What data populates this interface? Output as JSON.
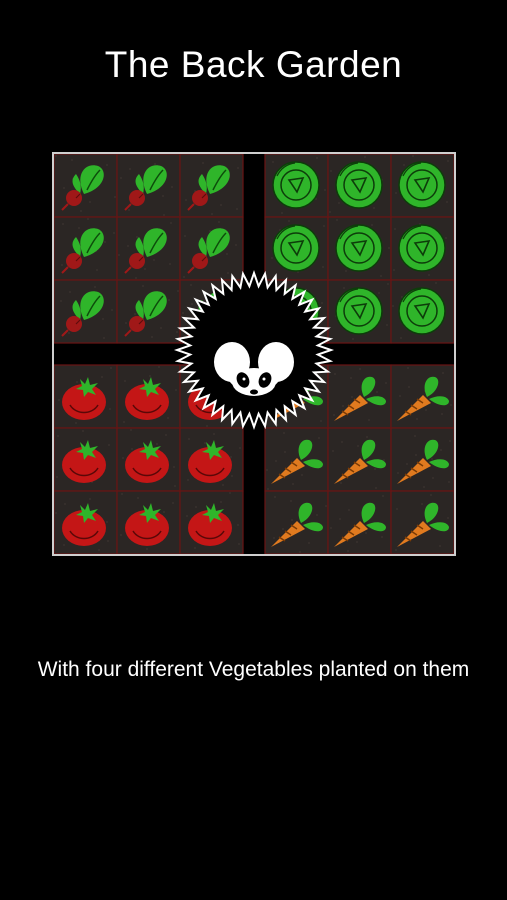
{
  "screen": {
    "title": "The Back Garden",
    "caption": "With four different Vegetables planted on them"
  },
  "garden": {
    "quadrants": {
      "top_left": "beet",
      "top_right": "cabbage",
      "bottom_left": "tomato",
      "bottom_right": "carrot"
    },
    "rows": [
      [
        "beet",
        "beet",
        "beet",
        "cabbage",
        "cabbage",
        "cabbage"
      ],
      [
        "beet",
        "beet",
        "beet",
        "cabbage",
        "cabbage",
        "cabbage"
      ],
      [
        "beet",
        "beet",
        "beet",
        "cabbage",
        "cabbage",
        "cabbage"
      ],
      [
        "tomato",
        "tomato",
        "tomato",
        "carrot",
        "carrot",
        "carrot"
      ],
      [
        "tomato",
        "tomato",
        "tomato",
        "carrot",
        "carrot",
        "carrot"
      ],
      [
        "tomato",
        "tomato",
        "tomato",
        "carrot",
        "carrot",
        "carrot"
      ]
    ],
    "colors": {
      "soil": "#2b2624",
      "plot_line": "#6a1414",
      "path": "#000000",
      "border": "#cfcfcf",
      "leaf_green": "#2fb52a",
      "beet_red": "#a01818",
      "tomato_red": "#c41616",
      "carrot_orange": "#e07a1f"
    }
  },
  "character": {
    "type": "hedgehog",
    "icon": "hedgehog-icon",
    "colors": {
      "body": "#000000",
      "spikes_outline": "#ffffff",
      "face": "#ffffff"
    }
  }
}
